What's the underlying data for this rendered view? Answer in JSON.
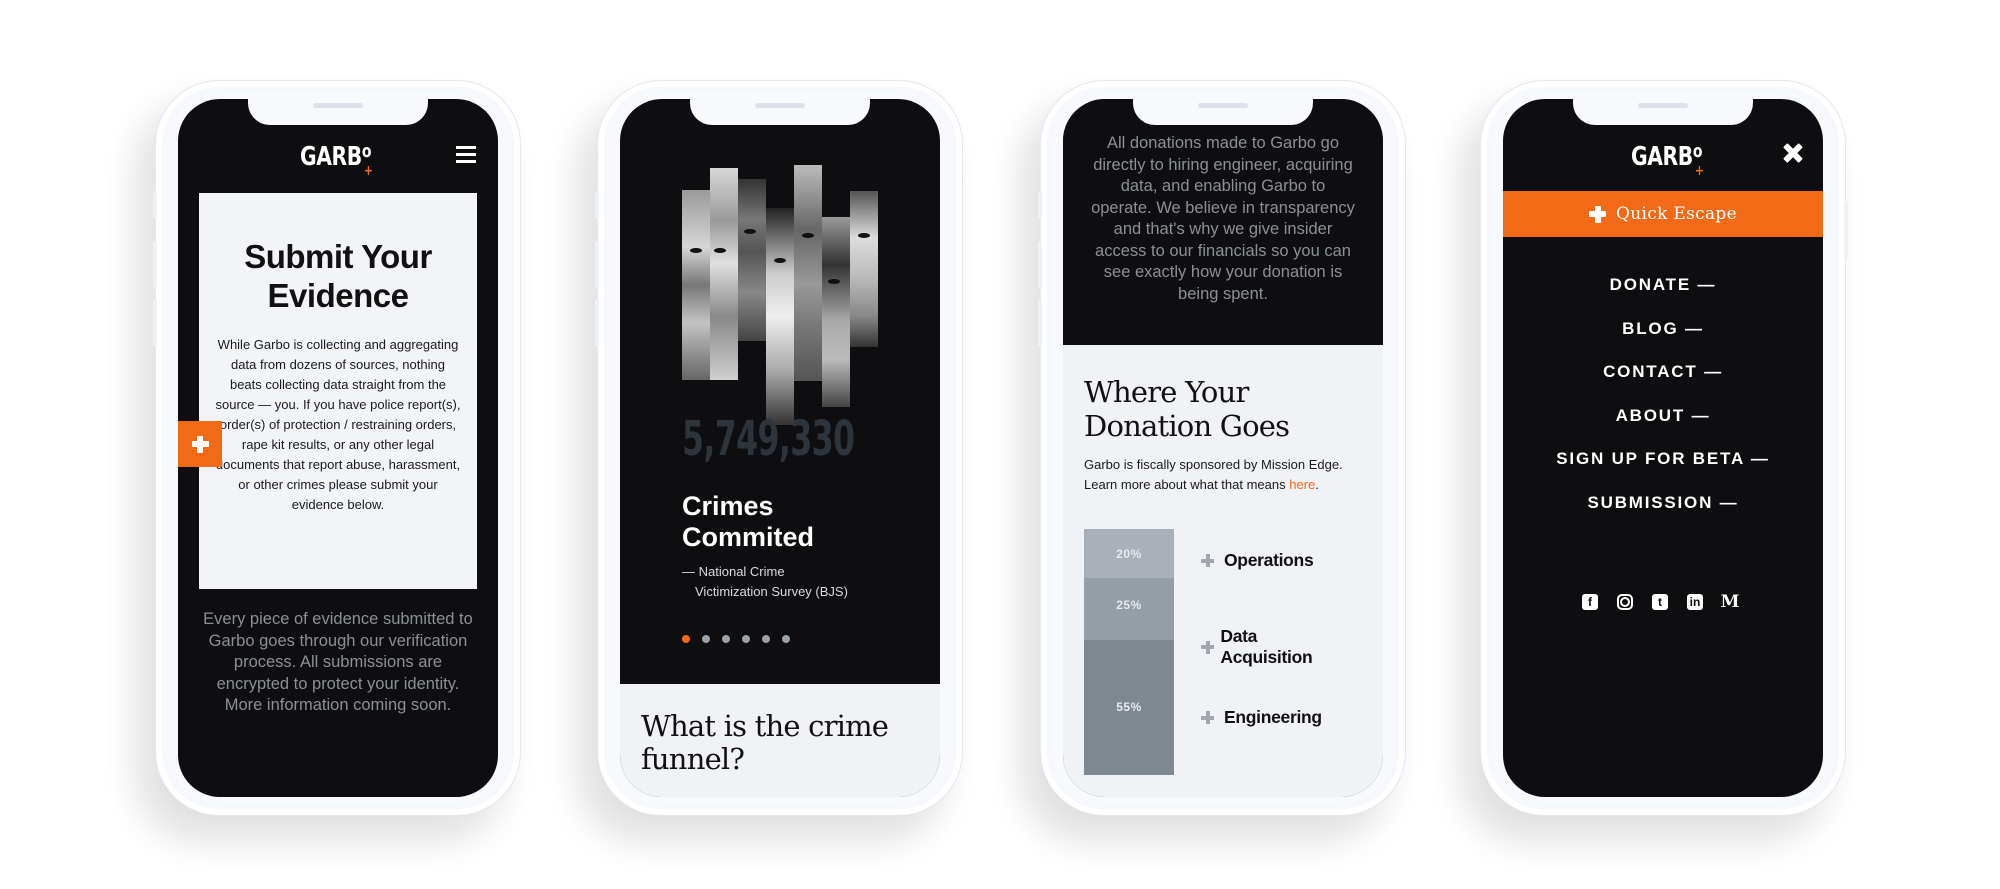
{
  "brand": {
    "logo_text": "GARB",
    "logo_o": "o",
    "logo_plus": "+",
    "accent_color": "#f26a17",
    "dark_color": "#0e0e10",
    "light_color": "#f0f2f6"
  },
  "phone1": {
    "menu_icon": "hamburger-icon",
    "title": "Submit Your Evidence",
    "body": "While Garbo is collecting and aggregating data from dozens of sources, nothing beats collecting data straight from the source — you. If you have police report(s), order(s) of protection / restraining orders, rape kit results, or any other legal documents that report abuse, harassment, or other crimes please submit your evidence below.",
    "side_tab_icon": "plus-icon",
    "footer": "Every piece of evidence submitted to Garbo goes through our verification process. All submissions are encrypted to protect your identity. More information coming soon."
  },
  "phone2": {
    "hero_image": "faces-collage",
    "stat_number": "5,749,330",
    "stat_label": "Crimes Commited",
    "source_line1": "— National Crime",
    "source_line2": "Victimization Survey (BJS)",
    "carousel": {
      "total": 6,
      "active_index": 0
    },
    "section_heading": "What is the crime funnel?"
  },
  "phone3": {
    "intro": "All donations made to Garbo go directly to hiring engineer, acquiring data, and enabling Garbo to operate. We believe in transparency and that's why we give insider access to our financials so you can see exactly how your donation is being spent.",
    "heading": "Where Your Donation Goes",
    "sponsor_text": "Garbo is fiscally sponsored by Mission Edge. Learn more about what that means ",
    "sponsor_link": "here",
    "sponsor_end": ".",
    "chart_data": {
      "type": "bar",
      "stacked": true,
      "categories": [
        "Operations",
        "Data Acquisition",
        "Engineering"
      ],
      "values": [
        20,
        25,
        55
      ],
      "labels": [
        "20%",
        "25%",
        "55%"
      ],
      "colors": [
        "#a9b0b7",
        "#959da5",
        "#7f8891"
      ],
      "unit": "%",
      "title": "Where Your Donation Goes",
      "legend_position": "right"
    }
  },
  "phone4": {
    "close_icon": "close-icon",
    "quick_escape": "Quick Escape",
    "nav": [
      "DONATE —",
      "BLOG —",
      "CONTACT —",
      "ABOUT —",
      "SIGN UP FOR BETA —",
      "SUBMISSION —"
    ],
    "socials": [
      {
        "name": "facebook",
        "glyph": "f"
      },
      {
        "name": "instagram",
        "glyph": ""
      },
      {
        "name": "twitter",
        "glyph": "t"
      },
      {
        "name": "linkedin",
        "glyph": "in"
      },
      {
        "name": "medium",
        "glyph": "M"
      }
    ]
  }
}
